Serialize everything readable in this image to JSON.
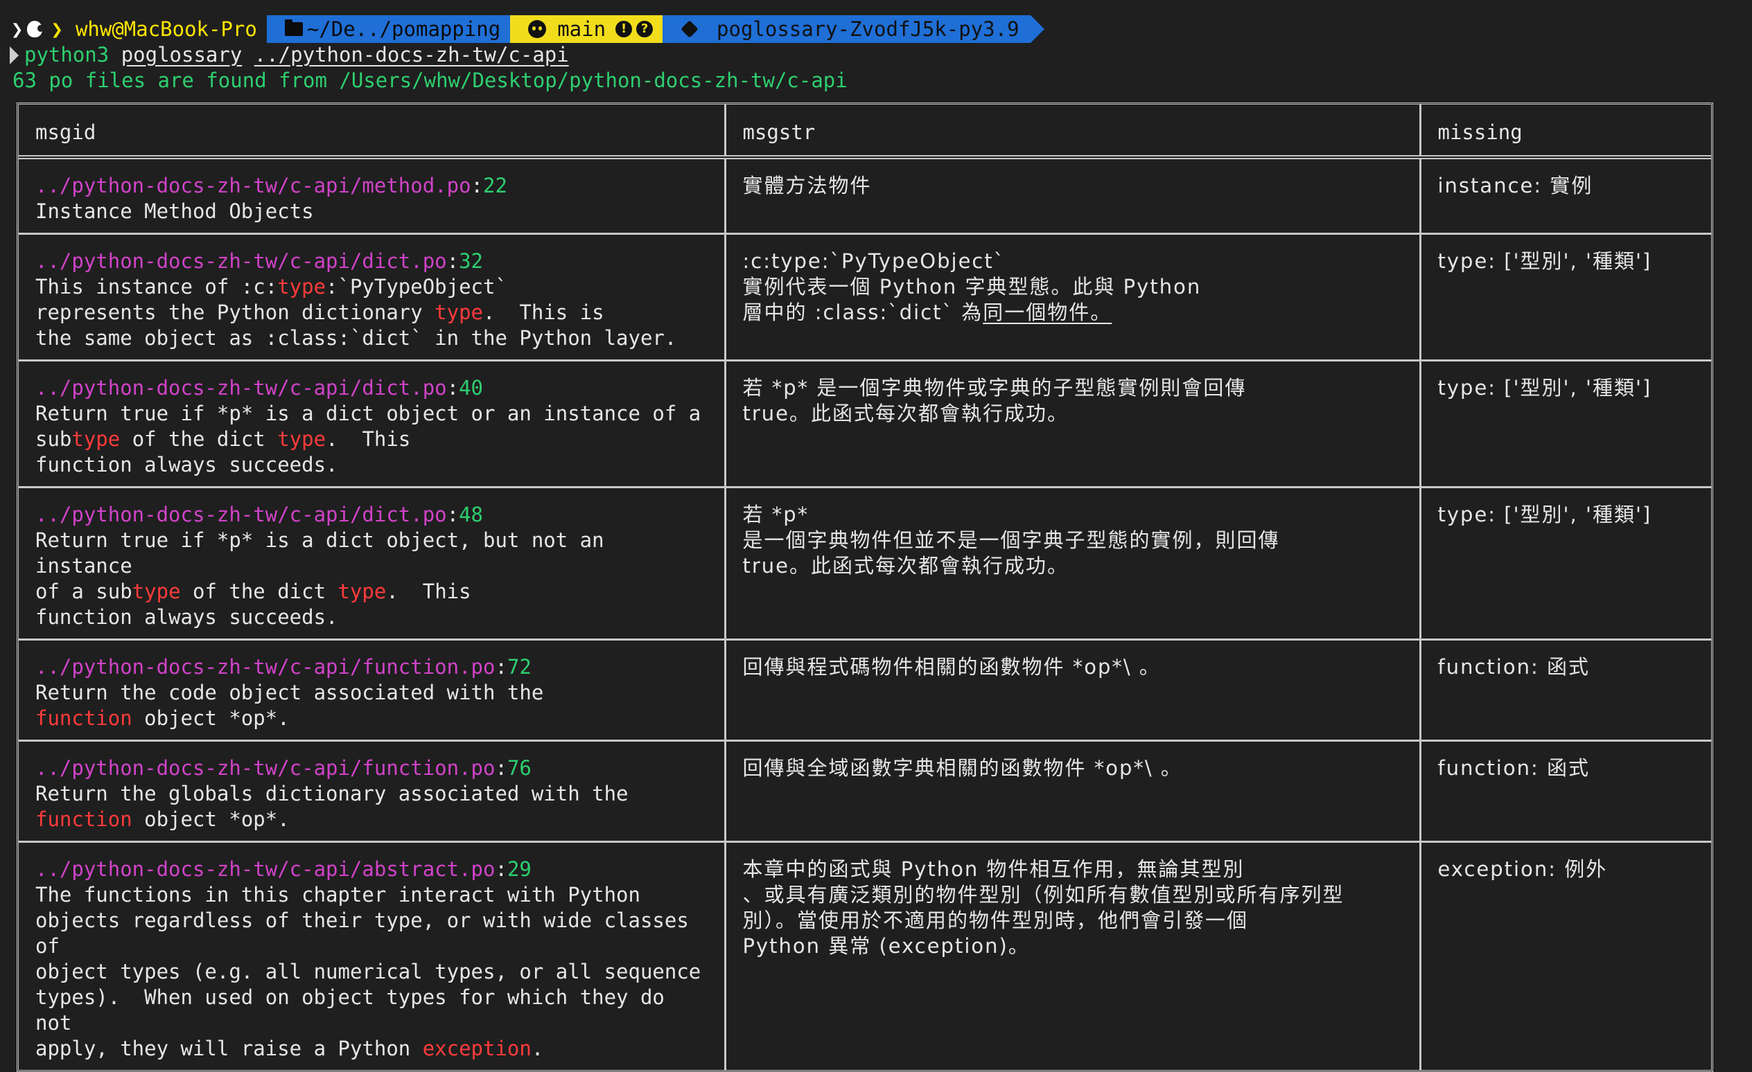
{
  "prompt": {
    "user_host": "whw@MacBook-Pro",
    "dir": "~/De../pomapping",
    "git_branch": "main",
    "git_badge_1": "!",
    "git_badge_2": "?",
    "venv": "poglossary-ZvodfJ5k-py3.9",
    "icons": [
      "chevron-right-icon",
      "apple-icon",
      "folder-icon",
      "github-icon",
      "exclamation-badge-icon",
      "question-badge-icon",
      "puzzle-icon"
    ]
  },
  "command": {
    "bin": "python3",
    "script": "poglossary",
    "arg": "../python-docs-zh-tw/c-api"
  },
  "found_line": "63 po files are found from /Users/whw/Desktop/python-docs-zh-tw/c-api",
  "table": {
    "headers": [
      "msgid",
      "msgstr",
      "missing"
    ],
    "rows": [
      {
        "path": "../python-docs-zh-tw/c-api/method.po",
        "colon": ":",
        "line": "22",
        "msgid_segments": [
          {
            "t": "Instance Method Objects",
            "hl": false
          }
        ],
        "msgstr_lines": [
          {
            "t": "實體方法物件",
            "u": false
          }
        ],
        "missing": "instance: 實例"
      },
      {
        "path": "../python-docs-zh-tw/c-api/dict.po",
        "colon": ":",
        "line": "32",
        "msgid_segments": [
          {
            "t": "This instance of :c:",
            "hl": false
          },
          {
            "t": "type",
            "hl": true
          },
          {
            "t": ":`PyTypeObject`\nrepresents the Python dictionary ",
            "hl": false
          },
          {
            "t": "type",
            "hl": true
          },
          {
            "t": ".  This is\nthe same object as :class:`dict` in the Python layer.",
            "hl": false
          }
        ],
        "msgstr_lines": [
          {
            "t": ":c:type:`PyTypeObject`",
            "u": false
          },
          {
            "t": "實例代表一個 Python 字典型態。此與 Python",
            "u": false
          },
          {
            "t": "層中的 :class:`dict` 為",
            "u": false,
            "tail": "同一個物件。"
          }
        ],
        "missing": "type: ['型別', '種類']"
      },
      {
        "path": "../python-docs-zh-tw/c-api/dict.po",
        "colon": ":",
        "line": "40",
        "msgid_segments": [
          {
            "t": "Return true if *p* is a dict object or an instance of a\nsub",
            "hl": false
          },
          {
            "t": "type",
            "hl": true
          },
          {
            "t": " of the dict ",
            "hl": false
          },
          {
            "t": "type",
            "hl": true
          },
          {
            "t": ".  This\nfunction always succeeds.",
            "hl": false
          }
        ],
        "msgstr_lines": [
          {
            "t": "若 *p* 是一個字典物件或字典的子型態實例則會回傳",
            "u": false
          },
          {
            "t": "true。此函式每次都會執行成功。",
            "u": false
          }
        ],
        "missing": "type: ['型別', '種類']"
      },
      {
        "path": "../python-docs-zh-tw/c-api/dict.po",
        "colon": ":",
        "line": "48",
        "msgid_segments": [
          {
            "t": "Return true if *p* is a dict object, but not an instance\nof a sub",
            "hl": false
          },
          {
            "t": "type",
            "hl": true
          },
          {
            "t": " of the dict ",
            "hl": false
          },
          {
            "t": "type",
            "hl": true
          },
          {
            "t": ".  This\nfunction always succeeds.",
            "hl": false
          }
        ],
        "msgstr_lines": [
          {
            "t": "若 *p*",
            "u": false
          },
          {
            "t": "是一個字典物件但並不是一個字典子型態的實例，則回傳",
            "u": false
          },
          {
            "t": "true。此函式每次都會執行成功。",
            "u": false
          }
        ],
        "missing": "type: ['型別', '種類']"
      },
      {
        "path": "../python-docs-zh-tw/c-api/function.po",
        "colon": ":",
        "line": "72",
        "msgid_segments": [
          {
            "t": "Return the code object associated with the\n",
            "hl": false
          },
          {
            "t": "function",
            "hl": true
          },
          {
            "t": " object *op*.",
            "hl": false
          }
        ],
        "msgstr_lines": [
          {
            "t": "回傳與程式碼物件相關的函數物件 *op*\\ 。",
            "u": false
          }
        ],
        "missing": "function: 函式"
      },
      {
        "path": "../python-docs-zh-tw/c-api/function.po",
        "colon": ":",
        "line": "76",
        "msgid_segments": [
          {
            "t": "Return the globals dictionary associated with the\n",
            "hl": false
          },
          {
            "t": "function",
            "hl": true
          },
          {
            "t": " object *op*.",
            "hl": false
          }
        ],
        "msgstr_lines": [
          {
            "t": "回傳與全域函數字典相關的函數物件 *op*\\ 。",
            "u": false
          }
        ],
        "missing": "function: 函式"
      },
      {
        "path": "../python-docs-zh-tw/c-api/abstract.po",
        "colon": ":",
        "line": "29",
        "msgid_segments": [
          {
            "t": "The functions in this chapter interact with Python\nobjects regardless of their type, or with wide classes of\nobject types (e.g. all numerical types, or all sequence\ntypes).  When used on object types for which they do not\napply, they will raise a Python ",
            "hl": false
          },
          {
            "t": "exception",
            "hl": true
          },
          {
            "t": ".",
            "hl": false
          }
        ],
        "msgstr_lines": [
          {
            "t": "本章中的函式與 Python 物件相互作用，無論其型別",
            "u": false
          },
          {
            "t": "、或具有廣泛類別的物件型別（例如所有數值型別或所有序列型",
            "u": false
          },
          {
            "t": "別）。當使用於不適用的物件型別時，他們會引發一個",
            "u": false
          },
          {
            "t": "Python 異常 (exception)。",
            "u": false
          }
        ],
        "missing": "exception: 例外"
      }
    ]
  },
  "colors": {
    "background": "#1f1f1f",
    "path": "#d043c8",
    "line_number": "#2ecf6f",
    "highlight": "#ff3b3b",
    "prompt_blue": "#1f6fd6",
    "prompt_yellow": "#f2dd1c",
    "success_green": "#2ecf6f"
  }
}
